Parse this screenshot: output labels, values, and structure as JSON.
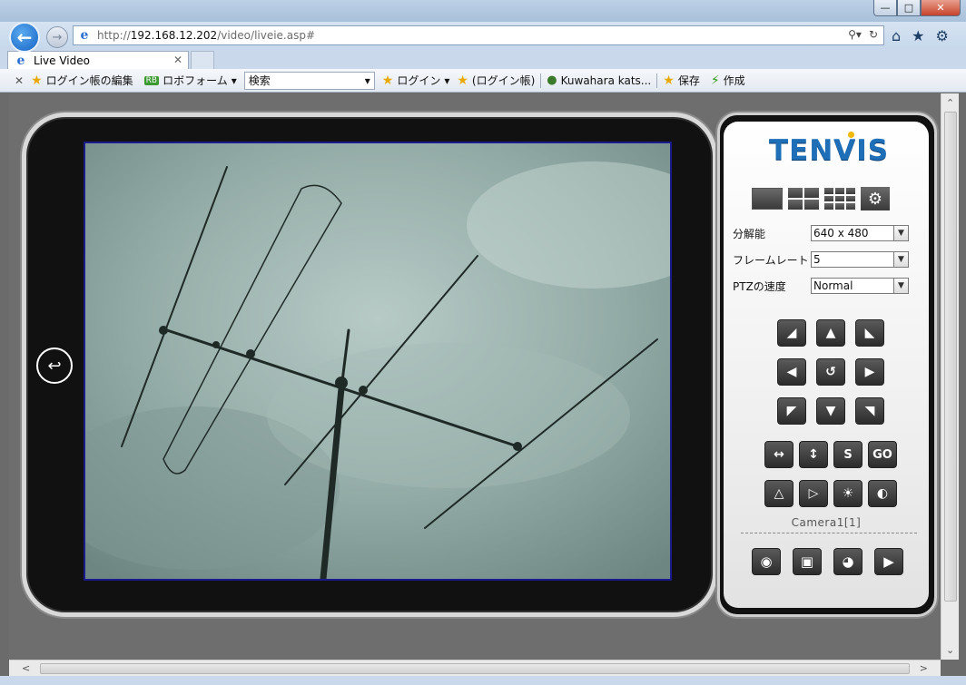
{
  "browser": {
    "url_prefix": "http://",
    "url_host": "192.168.12.202",
    "url_path": "/video/liveie.asp#",
    "tab_title": "Live Video"
  },
  "favorites": {
    "items": [
      "ログイン帳の編集",
      "ロボフォーム",
      "ログイン",
      "(ログイン帳)",
      "Kuwahara kats...",
      "保存",
      "作成"
    ],
    "search_label": "検索",
    "robo_icon_text": "RB"
  },
  "panel": {
    "brand": "TENVIS",
    "settings": [
      {
        "label": "分解能",
        "value": "640 x 480"
      },
      {
        "label": "フレームレート",
        "value": "5"
      },
      {
        "label": "PTZの速度",
        "value": "Normal"
      }
    ],
    "buttons": {
      "s_label": "S",
      "go_label": "GO"
    },
    "camera_label": "Camera1[1]"
  },
  "colors": {
    "brand_blue": "#1f6fb8",
    "brand_dot": "#f2b700",
    "video_border": "#1a1a8c"
  },
  "icons": {
    "back": "arrow-left-icon",
    "forward": "arrow-right-icon",
    "home": "home-icon",
    "favorites": "star-icon",
    "settings": "gear-icon"
  }
}
